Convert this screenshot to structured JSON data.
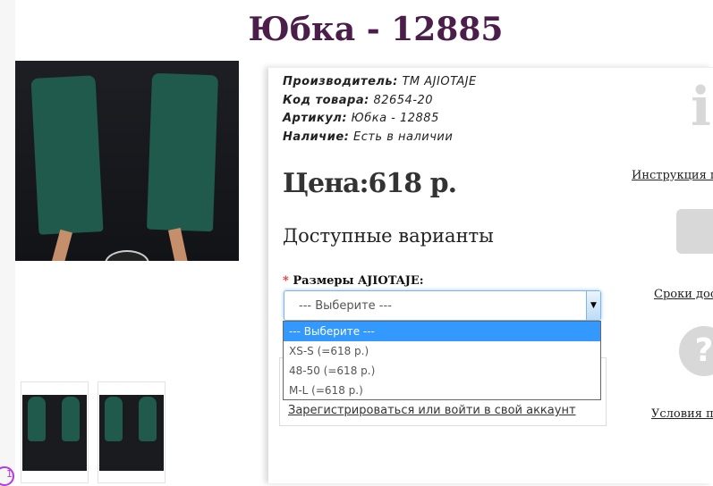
{
  "product": {
    "title": "Юбка - 12885",
    "manufacturer_label": "Производитель:",
    "manufacturer": "ТМ AJIOTAJE",
    "code_label": "Код товара:",
    "code": "82654-20",
    "article_label": "Артикул:",
    "article": "Юбка - 12885",
    "stock_label": "Наличие:",
    "stock": "Есть в наличии",
    "price": "Цена:618 р."
  },
  "options": {
    "heading": "Доступные варианты",
    "required_mark": "*",
    "size_label": "Размеры AJIOTAJE:",
    "selected": "--- Выберите ---",
    "items": [
      "--- Выберите ---",
      "XS-S (=618 р.)",
      "48-50 (=618 р.)",
      "M-L (=618 р.)"
    ]
  },
  "register_link": "Зарегистрироваться или войти в свой аккаунт",
  "side": {
    "instruction": "Инструкция п",
    "delivery": "Сроки дос",
    "conditions": "Условия п"
  },
  "colors": {
    "title": "#4a1d4a",
    "accent": "#3399ff"
  }
}
